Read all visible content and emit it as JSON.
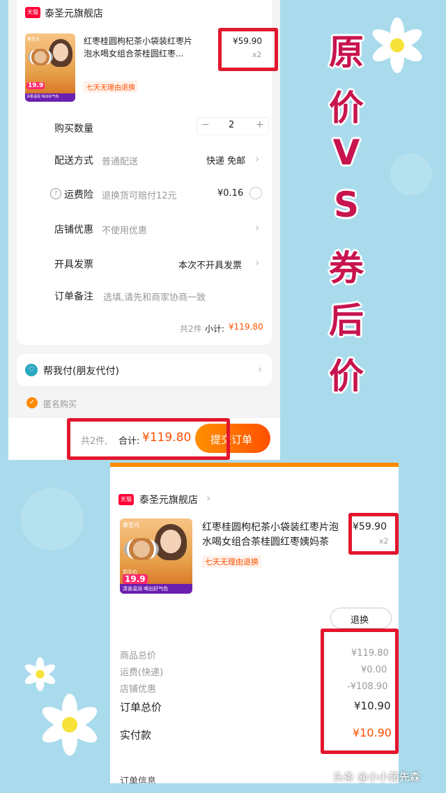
{
  "store_name": "泰圣元旗舰店",
  "tmall_badge": "天猫",
  "thumb_text": {
    "brand": "泰圣元",
    "promo": "到手价",
    "price": "19.9",
    "sub": "清香温润 喝出好气色"
  },
  "order_top": {
    "product_title_line1": "红枣桂圆枸杞茶小袋装红枣片",
    "product_title_line2": "泡水喝女组合茶桂圆红枣...",
    "price": "¥59.90",
    "qty_label": "x2",
    "return_tag": "七天无理由退换",
    "quantity_label": "购买数量",
    "quantity_value": "2",
    "qty_minus": "−",
    "qty_plus": "+",
    "delivery_label": "配送方式",
    "delivery_type": "普通配送",
    "delivery_value": "快递 免邮",
    "insurance_help": "?",
    "insurance_label": "运费险",
    "insurance_desc": "退换货可赔付12元",
    "insurance_price": "¥0.16",
    "discount_label": "店铺优惠",
    "discount_value": "不使用优惠",
    "invoice_label": "开具发票",
    "invoice_value": "本次不开具发票",
    "remark_label": "订单备注",
    "remark_placeholder": "选填,请先和商家协商一致",
    "subtotal_count": "共2件",
    "subtotal_label": "小计:",
    "subtotal_value": "¥119.80",
    "friend_pay": "帮我付(朋友代付)",
    "anonymous": "匿名购买",
    "footer_count": "共2件,",
    "footer_total_label": "合计:",
    "footer_total_value": "¥119.80",
    "submit": "提交订单"
  },
  "title_chars": [
    "原",
    "价",
    "V",
    "S",
    "券",
    "后",
    "价"
  ],
  "order_bottom": {
    "product_title_line1": "红枣桂圆枸杞茶小袋装红枣片泡",
    "product_title_line2": "水喝女组合茶桂圆红枣姨妈茶",
    "price": "¥59.90",
    "qty_label": "x2",
    "return_tag": "七天无理由退换",
    "refund_button": "退换",
    "goods_total_label": "商品总价",
    "goods_total_value": "¥119.80",
    "shipping_label": "运费(快递)",
    "shipping_value": "¥0.00",
    "store_discount_label": "店铺优惠",
    "store_discount_value": "-¥108.90",
    "order_total_label": "订单总价",
    "order_total_value": "¥10.90",
    "paid_label": "实付款",
    "paid_value": "¥10.90",
    "next_section": "订单信息"
  },
  "watermark": "头条 @小小茹先森",
  "colors": {
    "accent": "#ff5000",
    "highlight_box": "#e3162d",
    "title": "#c8144e",
    "background": "#a9dbec"
  }
}
